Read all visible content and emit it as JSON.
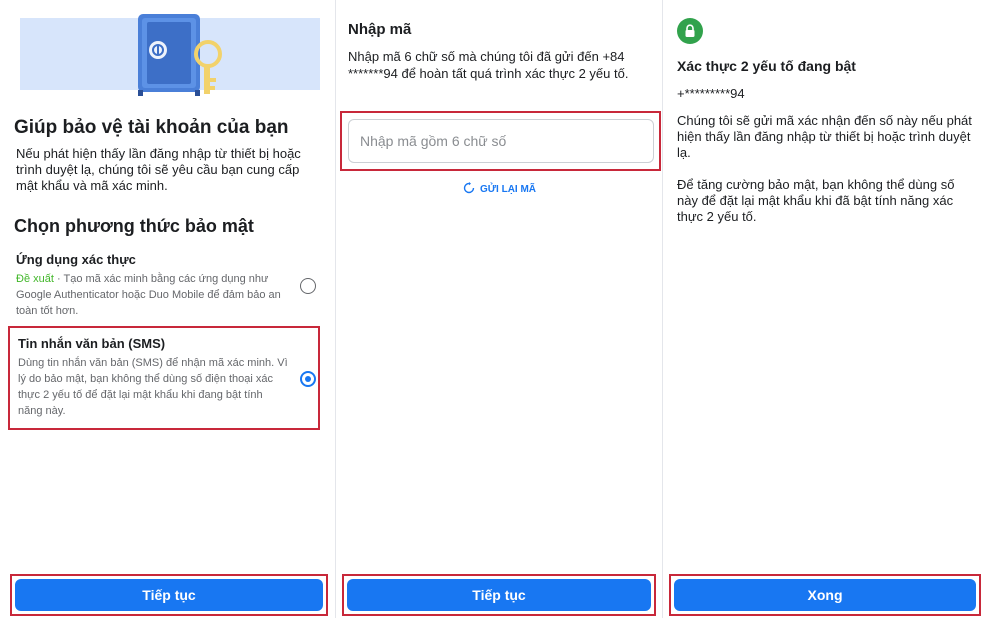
{
  "panel1": {
    "title": "Giúp bảo vệ tài khoản của bạn",
    "description": "Nếu phát hiện thấy lần đăng nhập từ thiết bị hoặc trình duyệt lạ, chúng tôi sẽ yêu cầu bạn cung cấp mật khẩu và mã xác minh.",
    "section_title": "Chọn phương thức bảo mật",
    "options": [
      {
        "title": "Ứng dụng xác thực",
        "recommended": "Đề xuất",
        "description": " · Tạo mã xác minh bằng các ứng dụng như Google Authenticator hoặc Duo Mobile để đảm bảo an toàn tốt hơn.",
        "selected": false
      },
      {
        "title": "Tin nhắn văn bản (SMS)",
        "description": "Dùng tin nhắn văn bản (SMS) để nhận mã xác minh. Vì lý do bảo mật, bạn không thể dùng số điện thoại xác thực 2 yếu tố để đặt lại mật khẩu khi đang bật tính năng này.",
        "selected": true
      }
    ],
    "continue_label": "Tiếp tục"
  },
  "panel2": {
    "title": "Nhập mã",
    "description": "Nhập mã 6 chữ số mà chúng tôi đã gửi đến +84 *******94 để hoàn tất quá trình xác thực 2 yếu tố.",
    "code_placeholder": "Nhập mã gồm 6 chữ số",
    "code_value": "",
    "resend_label": "GỬI LẠI MÃ",
    "continue_label": "Tiếp tục"
  },
  "panel3": {
    "title": "Xác thực 2 yếu tố đang bật",
    "phone": "+*********94",
    "description1": "Chúng tôi sẽ gửi mã xác nhận đến số này nếu phát hiện thấy lần đăng nhập từ thiết bị hoặc trình duyệt lạ.",
    "description2": "Để tăng cường bảo mật, bạn không thể dùng số này để đặt lại mật khẩu khi đã bật tính năng xác thực 2 yếu tố.",
    "done_label": "Xong"
  },
  "colors": {
    "primary": "#1877f2",
    "highlight": "#c8283a",
    "success": "#31a24c",
    "recommended": "#42b72a",
    "hero_bg": "#d7e5fb"
  },
  "icons": {
    "hero": "safe-with-key-icon",
    "resend": "refresh-icon",
    "lock": "lock-icon",
    "radio_off": "radio-unchecked-icon",
    "radio_on": "radio-checked-icon"
  }
}
